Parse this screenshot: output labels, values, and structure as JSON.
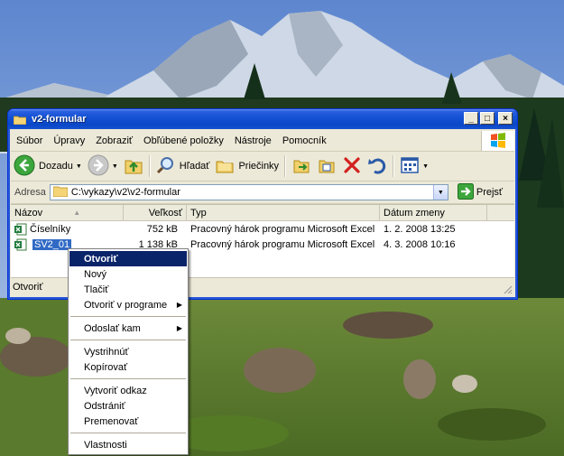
{
  "window": {
    "title": "v2-formular",
    "controls": {
      "minimize": "_",
      "maximize": "□",
      "close": "×"
    }
  },
  "menubar": {
    "items": [
      "Súbor",
      "Úpravy",
      "Zobraziť",
      "Obľúbené položky",
      "Nástroje",
      "Pomocník"
    ]
  },
  "toolbar": {
    "back_label": "Dozadu",
    "search_label": "Hľadať",
    "folders_label": "Priečinky"
  },
  "address": {
    "label": "Adresa",
    "value": "C:\\vykazy\\v2\\v2-formular",
    "go_label": "Prejsť"
  },
  "filelist": {
    "columns": [
      "Názov",
      "Veľkosť",
      "Typ",
      "Dátum zmeny"
    ],
    "rows": [
      {
        "name": "Číselníky",
        "size": "752 kB",
        "type": "Pracovný hárok programu Microsoft Excel",
        "date": "1. 2. 2008 13:25"
      },
      {
        "name": "SV2_01",
        "size": "1 138 kB",
        "type": "Pracovný hárok programu Microsoft Excel",
        "date": "4. 3. 2008 10:16"
      }
    ]
  },
  "statusbar": {
    "text": "Otvoriť"
  },
  "context_menu": {
    "open": "Otvoriť",
    "new": "Nový",
    "print": "Tlačiť",
    "open_with": "Otvoriť v programe",
    "send_to": "Odoslať kam",
    "cut": "Vystrihnúť",
    "copy": "Kopírovať",
    "create_shortcut": "Vytvoriť odkaz",
    "delete": "Odstrániť",
    "rename": "Premenovať",
    "properties": "Vlastnosti"
  },
  "colors": {
    "titlebar": "#0a47c8",
    "selection": "#316ac5",
    "menu_highlight": "#0a246a",
    "window_bg": "#ece9d8"
  }
}
